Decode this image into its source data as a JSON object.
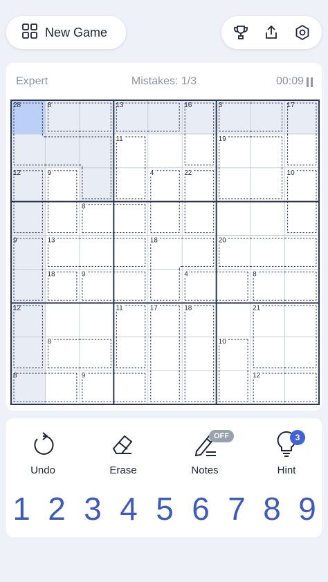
{
  "toolbar": {
    "new_game_label": "New Game",
    "icons": [
      "grid-icon",
      "trophy-icon",
      "share-icon",
      "settings-icon"
    ]
  },
  "status": {
    "difficulty": "Expert",
    "mistakes": "Mistakes: 1/3",
    "timer": "00:09"
  },
  "board": {
    "size": 9,
    "selected_cell": {
      "row": 0,
      "col": 0
    },
    "highlighted_cells": [
      [
        0,
        1
      ],
      [
        0,
        2
      ],
      [
        0,
        3
      ],
      [
        0,
        4
      ],
      [
        0,
        5
      ],
      [
        0,
        6
      ],
      [
        0,
        7
      ],
      [
        0,
        8
      ],
      [
        1,
        0
      ],
      [
        1,
        1
      ],
      [
        1,
        2
      ],
      [
        2,
        0
      ],
      [
        2,
        2
      ],
      [
        3,
        0
      ],
      [
        4,
        0
      ],
      [
        5,
        0
      ],
      [
        6,
        0
      ],
      [
        7,
        0
      ],
      [
        8,
        0
      ]
    ],
    "cages": [
      {
        "sum": 28,
        "cells": [
          [
            0,
            0
          ],
          [
            1,
            0
          ],
          [
            1,
            1
          ],
          [
            1,
            2
          ],
          [
            2,
            2
          ]
        ]
      },
      {
        "sum": 8,
        "cells": [
          [
            0,
            1
          ],
          [
            0,
            2
          ]
        ]
      },
      {
        "sum": 13,
        "cells": [
          [
            0,
            3
          ],
          [
            0,
            4
          ]
        ]
      },
      {
        "sum": 16,
        "cells": [
          [
            0,
            5
          ],
          [
            1,
            5
          ]
        ]
      },
      {
        "sum": 3,
        "cells": [
          [
            0,
            6
          ],
          [
            0,
            7
          ]
        ]
      },
      {
        "sum": 17,
        "cells": [
          [
            0,
            8
          ],
          [
            1,
            8
          ]
        ]
      },
      {
        "sum": 11,
        "cells": [
          [
            1,
            3
          ],
          [
            2,
            3
          ]
        ]
      },
      {
        "sum": 19,
        "cells": [
          [
            1,
            6
          ],
          [
            1,
            7
          ],
          [
            2,
            6
          ],
          [
            2,
            7
          ]
        ]
      },
      {
        "sum": 12,
        "cells": [
          [
            2,
            0
          ],
          [
            3,
            0
          ]
        ]
      },
      {
        "sum": 9,
        "cells": [
          [
            2,
            1
          ],
          [
            3,
            1
          ]
        ]
      },
      {
        "sum": 4,
        "cells": [
          [
            2,
            4
          ],
          [
            3,
            4
          ]
        ]
      },
      {
        "sum": 22,
        "cells": [
          [
            2,
            5
          ],
          [
            3,
            5
          ]
        ]
      },
      {
        "sum": 10,
        "cells": [
          [
            2,
            8
          ],
          [
            3,
            8
          ]
        ]
      },
      {
        "sum": 8,
        "cells": [
          [
            3,
            2
          ],
          [
            3,
            3
          ]
        ]
      },
      {
        "sum": 9,
        "cells": [
          [
            4,
            0
          ],
          [
            5,
            0
          ]
        ]
      },
      {
        "sum": 13,
        "cells": [
          [
            4,
            1
          ],
          [
            4,
            2
          ],
          [
            4,
            3
          ]
        ]
      },
      {
        "sum": 18,
        "cells": [
          [
            4,
            4
          ],
          [
            4,
            5
          ],
          [
            5,
            4
          ]
        ]
      },
      {
        "sum": 20,
        "cells": [
          [
            4,
            6
          ],
          [
            4,
            7
          ],
          [
            4,
            8
          ]
        ]
      },
      {
        "sum": 18,
        "cells": [
          [
            5,
            1
          ]
        ]
      },
      {
        "sum": 9,
        "cells": [
          [
            5,
            2
          ],
          [
            5,
            3
          ]
        ]
      },
      {
        "sum": 4,
        "cells": [
          [
            5,
            5
          ],
          [
            5,
            6
          ]
        ]
      },
      {
        "sum": 8,
        "cells": [
          [
            5,
            7
          ],
          [
            5,
            8
          ]
        ]
      },
      {
        "sum": 12,
        "cells": [
          [
            6,
            0
          ],
          [
            7,
            0
          ]
        ]
      },
      {
        "sum": 11,
        "cells": [
          [
            6,
            3
          ],
          [
            7,
            3
          ]
        ]
      },
      {
        "sum": 17,
        "cells": [
          [
            6,
            4
          ],
          [
            7,
            4
          ],
          [
            8,
            4
          ]
        ]
      },
      {
        "sum": 18,
        "cells": [
          [
            6,
            5
          ],
          [
            7,
            5
          ],
          [
            8,
            5
          ]
        ]
      },
      {
        "sum": 21,
        "cells": [
          [
            6,
            7
          ],
          [
            6,
            8
          ],
          [
            7,
            7
          ],
          [
            7,
            8
          ]
        ]
      },
      {
        "sum": 8,
        "cells": [
          [
            7,
            1
          ],
          [
            7,
            2
          ]
        ]
      },
      {
        "sum": 10,
        "cells": [
          [
            7,
            6
          ],
          [
            8,
            6
          ]
        ]
      },
      {
        "sum": 8,
        "cells": [
          [
            8,
            0
          ],
          [
            8,
            1
          ]
        ]
      },
      {
        "sum": 9,
        "cells": [
          [
            8,
            2
          ],
          [
            8,
            3
          ]
        ]
      },
      {
        "sum": 12,
        "cells": [
          [
            8,
            7
          ],
          [
            8,
            8
          ]
        ]
      }
    ]
  },
  "controls": {
    "undo": "Undo",
    "erase": "Erase",
    "notes": "Notes",
    "notes_state": "OFF",
    "hint": "Hint",
    "hint_count": "3"
  },
  "numpad": [
    "1",
    "2",
    "3",
    "4",
    "5",
    "6",
    "7",
    "8",
    "9"
  ],
  "colors": {
    "accent": "#3f5bb5",
    "badge": "#3f63d7",
    "selected_cell": "#bcd0f7",
    "highlight_cell": "#e8ecf4",
    "grid_thick": "#2a3550",
    "grid_thin": "#c9ced8"
  }
}
